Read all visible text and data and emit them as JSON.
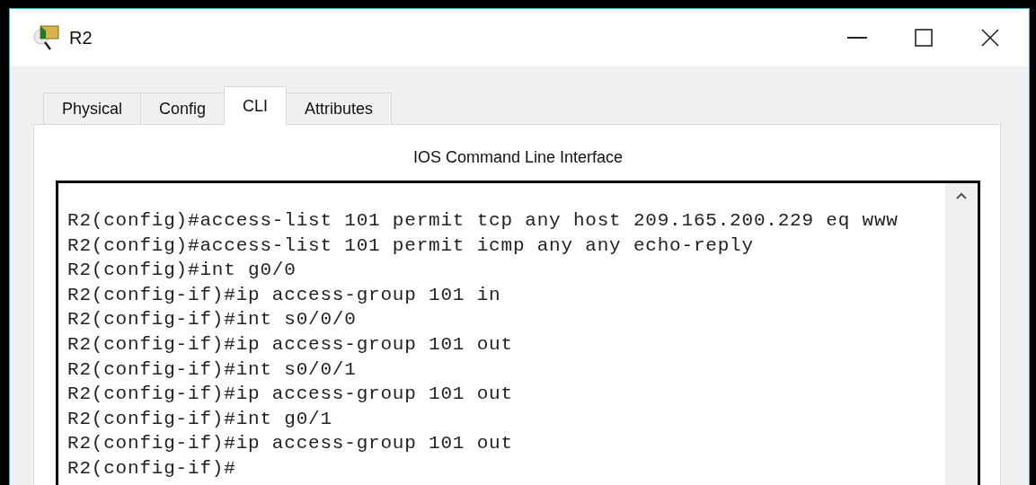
{
  "window": {
    "title": "R2"
  },
  "tabs": [
    {
      "label": "Physical",
      "selected": false
    },
    {
      "label": "Config",
      "selected": false
    },
    {
      "label": "CLI",
      "selected": true
    },
    {
      "label": "Attributes",
      "selected": false
    }
  ],
  "panel": {
    "heading": "IOS Command Line Interface"
  },
  "terminal": {
    "lines": [
      "R2(config)#access-list 101 permit tcp any host 209.165.200.229 eq www",
      "R2(config)#access-list 101 permit icmp any any echo-reply",
      "R2(config)#int g0/0",
      "R2(config-if)#ip access-group 101 in",
      "R2(config-if)#int s0/0/0",
      "R2(config-if)#ip access-group 101 out",
      "R2(config-if)#int s0/0/1",
      "R2(config-if)#ip access-group 101 out",
      "R2(config-if)#int g0/1",
      "R2(config-if)#ip access-group 101 out",
      "R2(config-if)#"
    ]
  }
}
